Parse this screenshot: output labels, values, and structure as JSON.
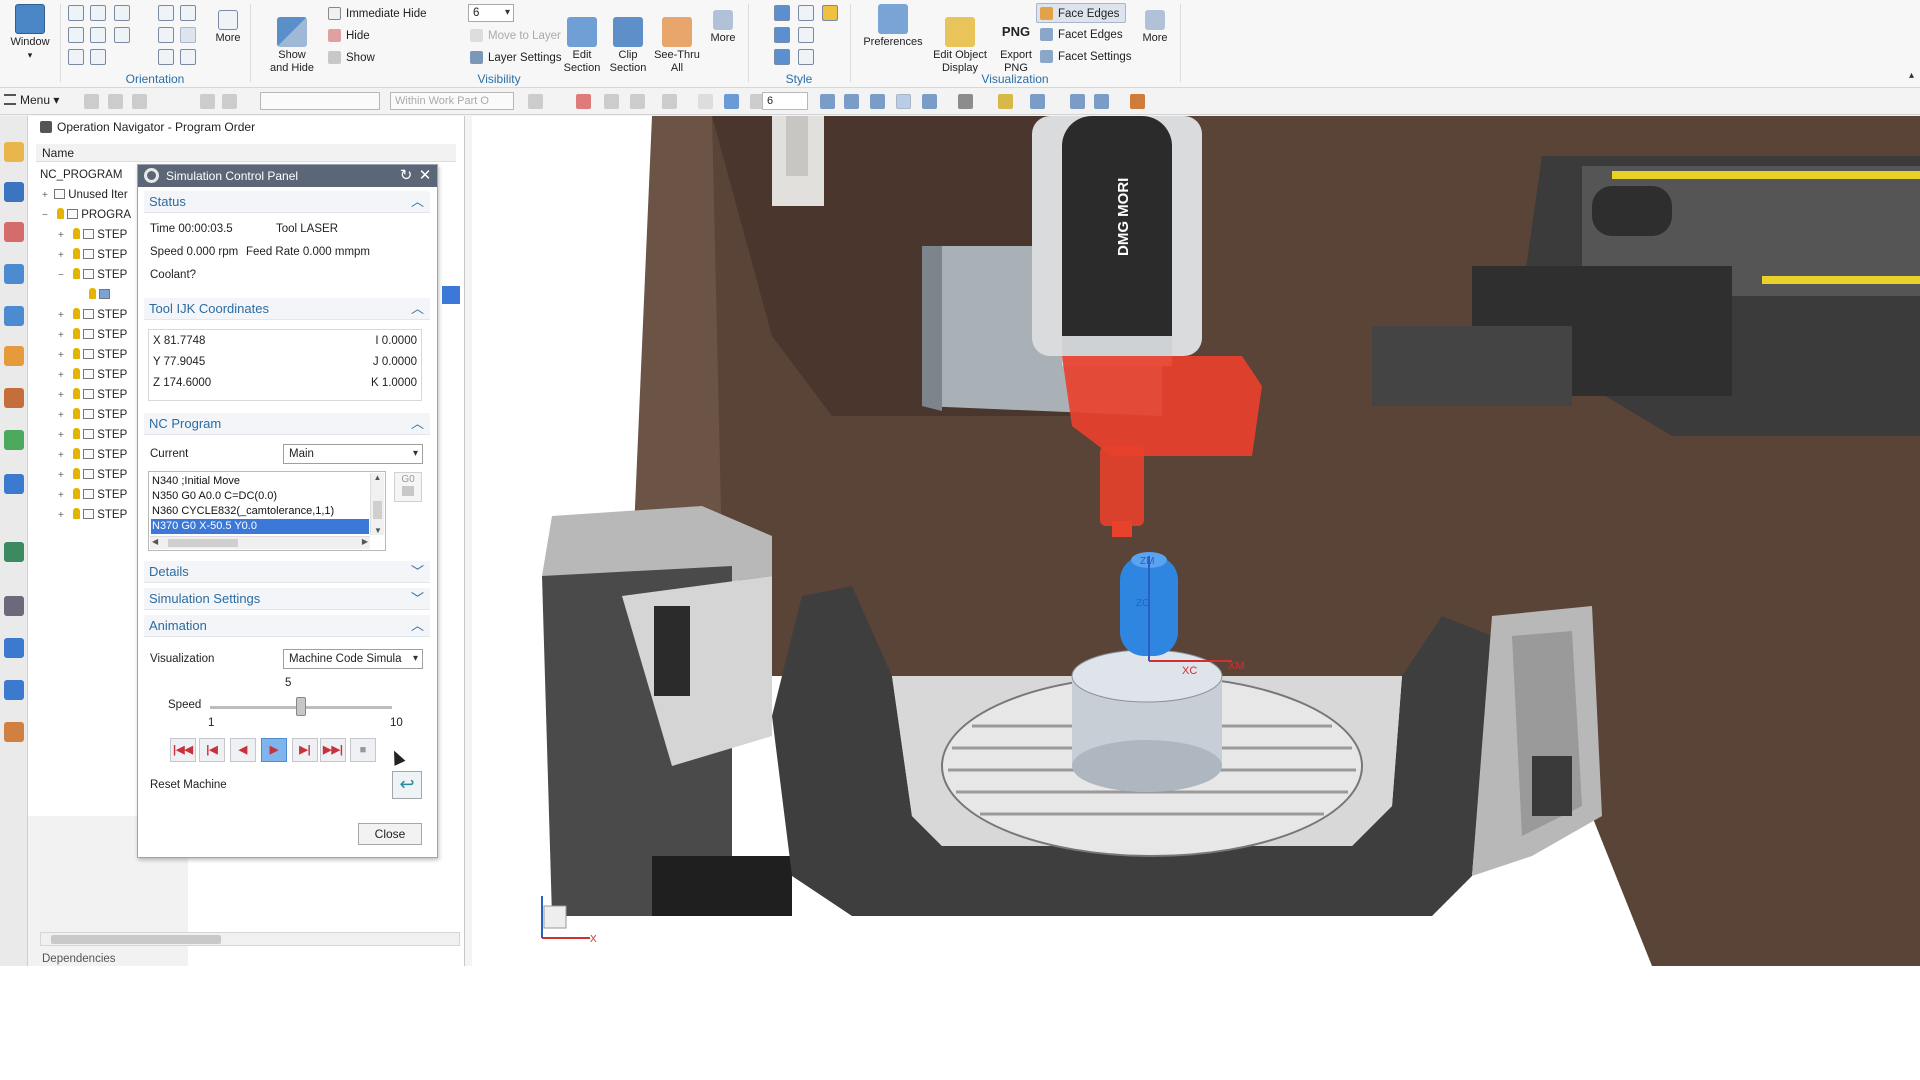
{
  "ribbon": {
    "window_label": "Window",
    "orientation": {
      "more_label": "More",
      "group_label": "Orientation"
    },
    "visibility": {
      "show_and_hide_label": "Show\nand Hide",
      "immediate_hide_label": "Immediate Hide",
      "hide_label": "Hide",
      "show_label": "Show",
      "layer_value": "6",
      "move_to_layer_label": "Move to Layer",
      "layer_settings_label": "Layer Settings",
      "edit_section_label": "Edit\nSection",
      "clip_section_label": "Clip\nSection",
      "see_thru_all_label": "See-Thru\nAll",
      "more_label": "More",
      "group_label": "Visibility"
    },
    "style": {
      "group_label": "Style"
    },
    "visualization": {
      "preferences_label": "Preferences",
      "edit_object_display_label": "Edit Object\nDisplay",
      "export_png_label": "Export\nPNG",
      "png_text": "PNG",
      "face_edges_label": "Face Edges",
      "facet_edges_label": "Facet Edges",
      "facet_settings_label": "Facet Settings",
      "more_label": "More",
      "group_label": "Visualization"
    }
  },
  "toolbar2": {
    "menu_label": "Menu",
    "filter_placeholder": "",
    "scope_value": "Within Work Part O",
    "layer_value": "6"
  },
  "navigator": {
    "title": "Operation Navigator - Program Order",
    "column_name": "Name",
    "rows": [
      {
        "label": "NC_PROGRAM"
      },
      {
        "label": "Unused Iter"
      },
      {
        "label": "PROGRA"
      },
      {
        "label": "STEP"
      },
      {
        "label": "STEP"
      },
      {
        "label": "STEP"
      },
      {
        "label": ""
      },
      {
        "label": "STEP"
      },
      {
        "label": "STEP"
      },
      {
        "label": "STEP"
      },
      {
        "label": "STEP"
      },
      {
        "label": "STEP"
      },
      {
        "label": "STEP"
      },
      {
        "label": "STEP"
      },
      {
        "label": "STEP"
      },
      {
        "label": "STEP"
      },
      {
        "label": "STEP"
      },
      {
        "label": "STEP"
      }
    ],
    "bottom_label": "Dependencies"
  },
  "sim_panel": {
    "title": "Simulation Control Panel",
    "status": {
      "header": "Status",
      "time": "Time 00:00:03.5",
      "tool": "Tool LASER",
      "speed": "Speed 0.000 rpm",
      "feed": "Feed Rate 0.000 mmpm",
      "coolant": "Coolant?"
    },
    "ijk": {
      "header": "Tool IJK Coordinates",
      "x": "X 81.7748",
      "y": "Y 77.9045",
      "z": "Z 174.6000",
      "i": "I 0.0000",
      "j": "J 0.0000",
      "k": "K 1.0000"
    },
    "nc_program": {
      "header": "NC Program",
      "current_label": "Current",
      "current_value": "Main",
      "lines": [
        "N340 ;Initial Move",
        "N350 G0 A0.0 C=DC(0.0)",
        "N360 CYCLE832(_camtolerance,1,1)",
        "N370 G0 X-50.5 Y0.0"
      ],
      "g0_label": "G0"
    },
    "details_header": "Details",
    "settings_header": "Simulation Settings",
    "animation": {
      "header": "Animation",
      "visualization_label": "Visualization",
      "visualization_value": "Machine Code Simula",
      "speed_label": "Speed",
      "speed_current": "5",
      "speed_min": "1",
      "speed_max": "10",
      "speed_level": 0.5,
      "reset_label": "Reset Machine"
    },
    "close_label": "Close"
  },
  "viewport": {
    "brand_text": "DMG MORI",
    "axes": {
      "x": "X",
      "xc": "XC",
      "xm": "XM",
      "zc": "ZC",
      "zm": "ZM"
    }
  },
  "colors": {
    "accent": "#2b6ca3",
    "selection": "#3c78d8",
    "tool_highlight": "#e8412c",
    "workpiece": "#2f86e0",
    "machine_base": "#5a4438"
  }
}
